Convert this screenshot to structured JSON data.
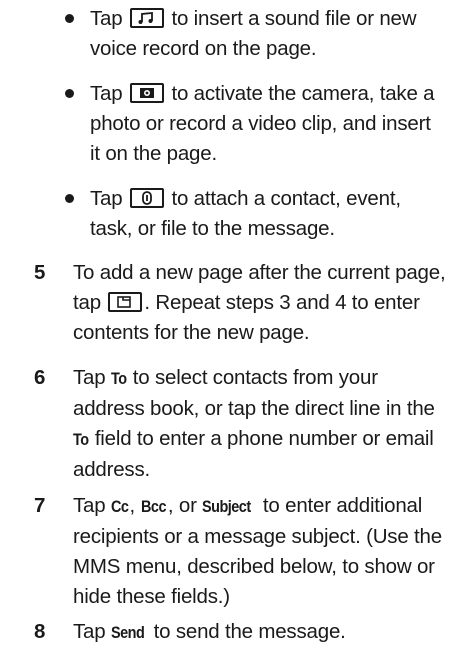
{
  "bullets": [
    {
      "before": "Tap",
      "icon": "sound-file-icon",
      "after_first": "to insert a sound file or new",
      "rest": "voice record on the page."
    },
    {
      "before": "Tap",
      "icon": "camera-icon",
      "after_first": "to activate the camera, take a",
      "rest": [
        "photo or record a video clip, and insert",
        "it on the page."
      ]
    },
    {
      "before": "Tap",
      "icon": "attach-icon",
      "after_first": "to attach a contact, event,",
      "rest": "task, or file to the message."
    }
  ],
  "steps": {
    "s5": {
      "number": "5",
      "l1": "To add a new page after the current page,",
      "l2_before": "tap",
      "l2_icon": "new-page-icon",
      "l2_after": ". Repeat steps 3 and 4 to enter",
      "l3": "contents for the new page."
    },
    "s6": {
      "number": "6",
      "l1_before": "Tap",
      "l1_term": "To",
      "l1_after": "to select contacts from your",
      "l2": "address book, or tap the direct line in the",
      "l3_term": "To",
      "l3_after": "field to enter a phone number or email",
      "l4": "address."
    },
    "s7": {
      "number": "7",
      "l1_before": "Tap",
      "l1_term1": "Cc",
      "l1_sep1": ",",
      "l1_term2": "Bcc",
      "l1_sep2": ", or",
      "l1_term3": "Subject",
      "l1_after": "to enter additional",
      "l2": "recipients or a message subject. (Use the",
      "l3": "MMS menu, described below, to show or",
      "l4": "hide these fields.)"
    },
    "s8": {
      "number": "8",
      "l1_before": "Tap",
      "l1_term": "Send",
      "l1_after": "to send the message."
    }
  }
}
